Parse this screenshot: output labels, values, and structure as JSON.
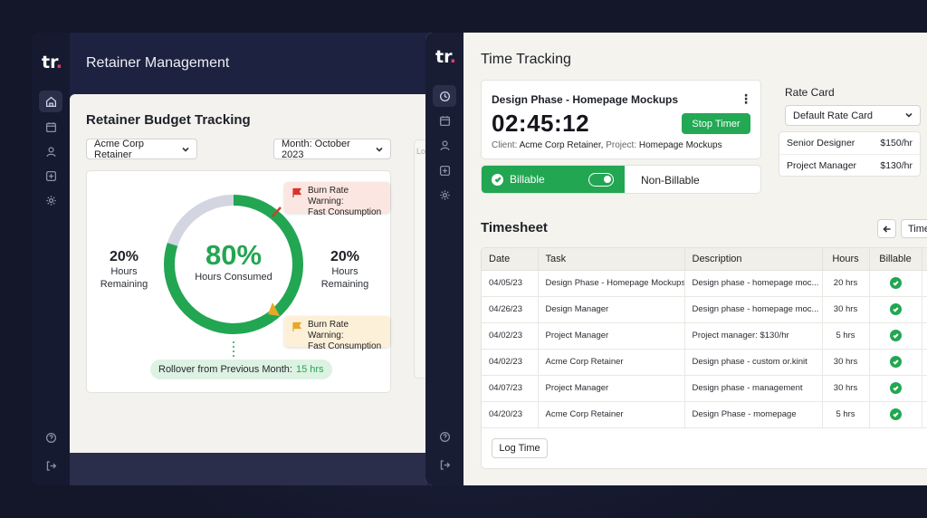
{
  "brand": {
    "logo_text": "tr",
    "logo_dot": "."
  },
  "left_window": {
    "header_title": "Retainer Management",
    "panel_title": "Retainer Budget Tracking",
    "retainer_dropdown": "Acme Corp Retainer",
    "month_dropdown": "Month: October 2023",
    "ghost_label": "Lo",
    "gauge": {
      "consumed_pct_value": 80,
      "consumed_pct": "80%",
      "consumed_label": "Hours Consumed",
      "left_pct": "20%",
      "left_label_1": "Hours",
      "left_label_2": "Remaining",
      "right_pct": "20%",
      "right_label_1": "Hours",
      "right_label_2": "Remaining",
      "warning_top_1": "Burn Rate Warning:",
      "warning_top_2": "Fast Consumption",
      "warning_bottom_1": "Burn Rate Warning:",
      "warning_bottom_2": "Fast Consumption",
      "rollover_label": "Rollover from Previous Month:",
      "rollover_value": "15 hrs"
    }
  },
  "right_window": {
    "title": "Time Tracking",
    "timer": {
      "task": "Design Phase - Homepage Mockups",
      "elapsed": "02:45:12",
      "client_label": "Client:",
      "client": "Acme Corp Retainer,",
      "project_label": "Project:",
      "project": "Homepage Mockups",
      "stop_label": "Stop Timer",
      "more_label": "⋮"
    },
    "billing": {
      "billable": "Billable",
      "non_billable": "Non-Billable"
    },
    "rate_card": {
      "title": "Rate Card",
      "selected": "Default Rate Card",
      "rows": [
        {
          "role": "Senior Designer",
          "rate": "$150/hr"
        },
        {
          "role": "Project Manager",
          "rate": "$130/hr"
        }
      ]
    },
    "timesheet": {
      "title": "Timesheet",
      "time_dropdown": "Time",
      "columns": [
        "Date",
        "Task",
        "Description",
        "Hours",
        "Billable"
      ],
      "rows": [
        {
          "date": "04/05/23",
          "task": "Design Phase - Homepage Mockups",
          "description": "Design phase - homepage moc...",
          "hours": "20 hrs"
        },
        {
          "date": "04/26/23",
          "task": "Design Manager",
          "description": "Design phase - homepage moc...",
          "hours": "30 hrs"
        },
        {
          "date": "04/02/23",
          "task": "Project Manager",
          "description": "Project manager: $130/hr",
          "hours": "5 hrs"
        },
        {
          "date": "04/02/23",
          "task": "Acme Corp Retainer",
          "description": "Design phase - custom or.kinit",
          "hours": "30 hrs"
        },
        {
          "date": "04/07/23",
          "task": "Project Manager",
          "description": "Design phase - management",
          "hours": "30 hrs"
        },
        {
          "date": "04/20/23",
          "task": "Acme Corp Retainer",
          "description": "Design Phase - momepage",
          "hours": "5 hrs"
        }
      ],
      "log_time_label": "Log Time"
    }
  },
  "colors": {
    "accent_green": "#22a652",
    "warning_red": "#fbe6e2",
    "warning_orange": "#fdf0d9",
    "brand_dot": "#e63a6f"
  }
}
